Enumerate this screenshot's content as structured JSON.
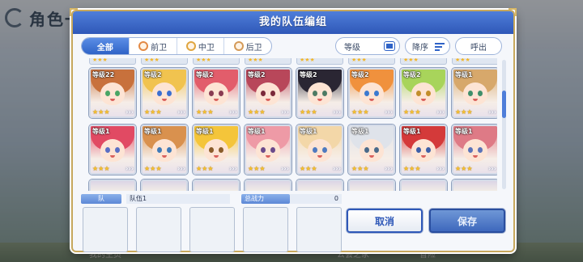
{
  "background": {
    "title": "角色一览",
    "bottom_tabs": [
      "我的主页",
      "",
      "",
      "公会之家",
      "",
      "冒险"
    ]
  },
  "dialog": {
    "title": "我的队伍编组"
  },
  "filters": {
    "tabs": [
      {
        "label": "全部",
        "icon": "",
        "active": true
      },
      {
        "label": "前卫",
        "icon": "front-role-icon",
        "active": false
      },
      {
        "label": "中卫",
        "icon": "middle-role-icon",
        "active": false
      },
      {
        "label": "后卫",
        "icon": "back-role-icon",
        "active": false
      }
    ],
    "sort_label": "等级",
    "order_label": "降序",
    "summon_label": "呼出"
  },
  "roster": {
    "rows": [
      [
        {
          "level": "等级22",
          "stars": "★★★",
          "hair": "#c8713c",
          "eyes": "#4aa565"
        },
        {
          "level": "等级2",
          "stars": "★★★",
          "hair": "#f1c34f",
          "eyes": "#3b6fd1"
        },
        {
          "level": "等级2",
          "stars": "★★★",
          "hair": "#e25d6b",
          "eyes": "#8a3b52"
        },
        {
          "level": "等级2",
          "stars": "★★★",
          "hair": "#b8475a",
          "eyes": "#7b2a3a"
        },
        {
          "level": "等级2",
          "stars": "★★★",
          "hair": "#2a2633",
          "eyes": "#4d7a63"
        },
        {
          "level": "等级2",
          "stars": "★★★",
          "hair": "#f0913d",
          "eyes": "#3c7ad0"
        },
        {
          "level": "等级2",
          "stars": "★★★",
          "hair": "#a8d45b",
          "eyes": "#c28d2a"
        },
        {
          "level": "等级1",
          "stars": "★★★",
          "hair": "#d7a86b",
          "eyes": "#3f8f6b"
        }
      ],
      [
        {
          "level": "等级1",
          "stars": "★★★",
          "hair": "#e14a63",
          "eyes": "#5a6fc4"
        },
        {
          "level": "等级1",
          "stars": "★★★",
          "hair": "#d9914e",
          "eyes": "#3f7ab8"
        },
        {
          "level": "等级1",
          "stars": "★★★",
          "hair": "#f4c53a",
          "eyes": "#8a5c2a"
        },
        {
          "level": "等级1",
          "stars": "★★★",
          "hair": "#ee9aa6",
          "eyes": "#6b4a8a"
        },
        {
          "level": "等级1",
          "stars": "★★★",
          "hair": "#f3d7a8",
          "eyes": "#4f7ac0"
        },
        {
          "level": "等级1",
          "stars": "★★★",
          "hair": "#dfe3ea",
          "eyes": "#4a6a8a"
        },
        {
          "level": "等级1",
          "stars": "★★★",
          "hair": "#d43a3a",
          "eyes": "#3d5fa8"
        },
        {
          "level": "等级1",
          "stars": "★★★",
          "hair": "#de7a86",
          "eyes": "#5b73b8"
        }
      ]
    ]
  },
  "team": {
    "label": "队",
    "name": "队伍1",
    "power_label": "总战力",
    "power_value": "0"
  },
  "buttons": {
    "cancel": "取消",
    "save": "保存"
  },
  "colors": {
    "header": "#2f58b8",
    "accent": "#4f7ed9",
    "frame_gold": "#c7a85d"
  }
}
